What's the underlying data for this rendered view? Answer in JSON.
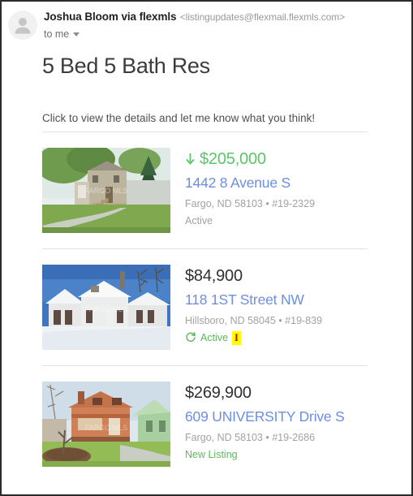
{
  "email": {
    "sender_name": "Joshua Bloom via flexmls",
    "sender_email": "<listingupdates@flexmail.flexmls.com>",
    "recipient": "to me",
    "recipient_caret_icon": "chevron-down-icon",
    "avatar_icon": "person-avatar-icon",
    "subject": "5 Bed 5 Bath Res"
  },
  "body": {
    "intro": "Click to view the details and let me know what you think!"
  },
  "listings": [
    {
      "price": "$205,000",
      "price_drop": true,
      "price_arrow_icon": "arrow-down-icon",
      "price_color": "#5cc46a",
      "address": "1442 8 Avenue S",
      "meta": "Fargo, ND 58103 • #19-2329",
      "status": "Active",
      "status_color": "#a2a2a2",
      "status_icon": "",
      "badge": "",
      "photo_alt": "beige-two-story-house-green-lawn"
    },
    {
      "price": "$84,900",
      "price_drop": false,
      "price_arrow_icon": "",
      "price_color": "#2f2f2f",
      "address": "118 1ST Street NW",
      "meta": "Hillsboro, ND 58045 • #19-839",
      "status": "Active",
      "status_color": "#5cb85c",
      "status_icon": "refresh-icon",
      "badge": "I",
      "badge_bg": "#ffff00",
      "badge_color": "#cc0000",
      "photo_alt": "white-bungalow-in-snow"
    },
    {
      "price": "$269,900",
      "price_drop": false,
      "price_arrow_icon": "",
      "price_color": "#2f2f2f",
      "address": "609 UNIVERSITY Drive S",
      "meta": "Fargo, ND 58103 • #19-2686",
      "status": "New Listing",
      "status_color": "#5cb85c",
      "status_icon": "",
      "badge": "",
      "photo_alt": "orange-two-story-house-green-neighbor"
    }
  ],
  "colors": {
    "link": "#6d8fe0",
    "green": "#5cb85c",
    "price_drop_green": "#5cc46a",
    "meta_gray": "#a2a2a2",
    "rule": "#e2e2e2",
    "frame": "#2b2b2b"
  }
}
